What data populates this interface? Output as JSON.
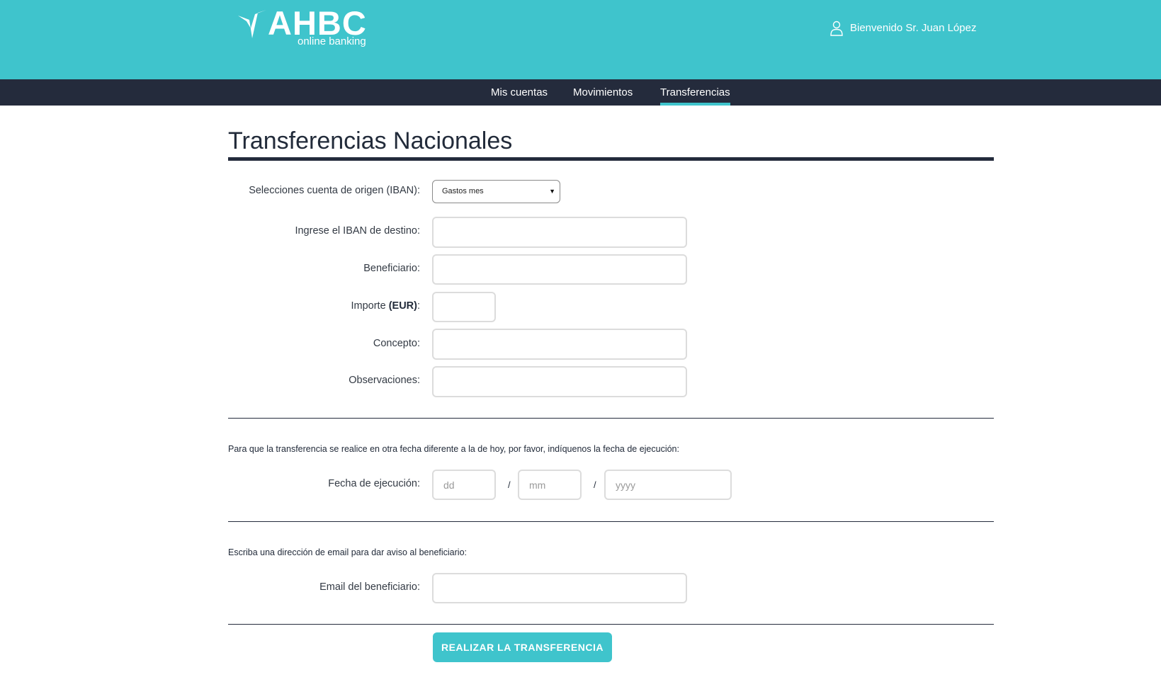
{
  "brand": {
    "name": "AHBC",
    "subtitle": "online banking",
    "logo_icon": "bird-icon",
    "accent_color": "#3fc4cc",
    "dark_color": "#242b3c"
  },
  "header": {
    "welcome": "Bienvenido Sr. Juan López",
    "user_icon": "user-icon"
  },
  "nav": {
    "items": [
      {
        "label": "Mis cuentas",
        "active": false
      },
      {
        "label": "Movimientos",
        "active": false
      },
      {
        "label": "Transferencias",
        "active": true
      }
    ]
  },
  "page": {
    "title": "Transferencias Nacionales"
  },
  "form": {
    "origin_label": "Selecciones cuenta de origen (IBAN):",
    "origin_selected": "Gastos mes",
    "iban_label": "Ingrese el IBAN de destino:",
    "iban_value": "",
    "beneficiary_label": "Beneficiario:",
    "beneficiary_value": "",
    "amount_label_prefix": "Importe",
    "amount_label_currency": "(EUR)",
    "amount_label_suffix": ":",
    "amount_value": "",
    "concept_label": "Concepto:",
    "concept_value": "",
    "observations_label": "Observaciones:",
    "observations_value": ""
  },
  "date_section": {
    "note": "Para que la transferencia se realice en otra fecha diferente a la de hoy, por favor, indíquenos la fecha de ejecución:",
    "label": "Fecha de ejecución:",
    "day_placeholder": "dd",
    "month_placeholder": "mm",
    "year_placeholder": "yyyy",
    "separator": "/"
  },
  "email_section": {
    "note": "Escriba una dirección de email para dar aviso al beneficiario:",
    "label": "Email del beneficiario:",
    "value": ""
  },
  "submit_label": "REALIZAR LA TRANSFERENCIA"
}
